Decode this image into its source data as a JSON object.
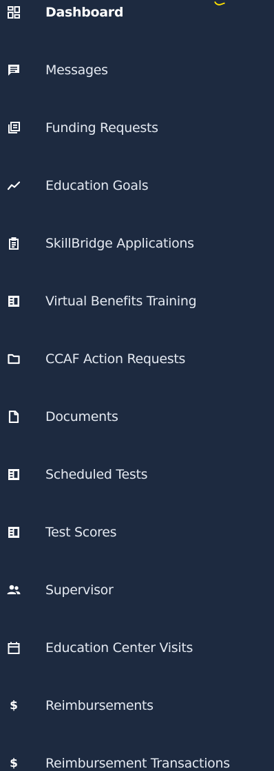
{
  "nav": {
    "items": [
      {
        "label": "Dashboard",
        "icon": "dashboard-icon",
        "active": true
      },
      {
        "label": "Messages",
        "icon": "message-icon"
      },
      {
        "label": "Funding Requests",
        "icon": "funding-requests-icon"
      },
      {
        "label": "Education Goals",
        "icon": "trend-line-icon"
      },
      {
        "label": "SkillBridge Applications",
        "icon": "clipboard-icon"
      },
      {
        "label": "Virtual Benefits Training",
        "icon": "id-card-icon"
      },
      {
        "label": "CCAF Action Requests",
        "icon": "folder-icon"
      },
      {
        "label": "Documents",
        "icon": "document-icon"
      },
      {
        "label": "Scheduled Tests",
        "icon": "id-card-icon"
      },
      {
        "label": "Test Scores",
        "icon": "id-card-icon"
      },
      {
        "label": "Supervisor",
        "icon": "people-icon"
      },
      {
        "label": "Education Center Visits",
        "icon": "calendar-icon"
      },
      {
        "label": "Reimbursements",
        "icon": "dollar-icon"
      },
      {
        "label": "Reimbursement Transactions",
        "icon": "dollar-icon"
      }
    ]
  },
  "colors": {
    "background": "#1d2a40",
    "text": "#e4e9f1",
    "icon": "#ffffff",
    "cursor_highlight": "#ffe000"
  }
}
